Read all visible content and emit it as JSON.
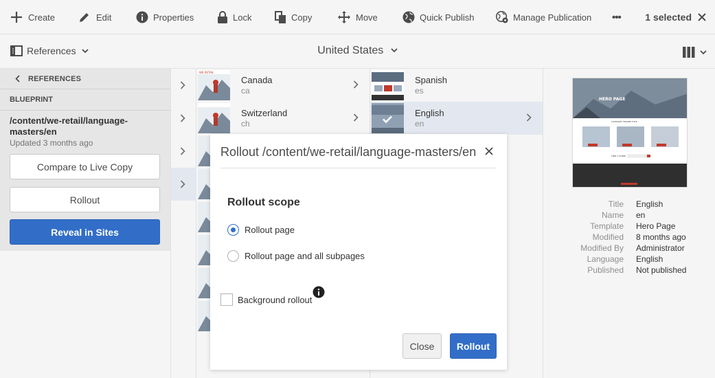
{
  "toolbar": {
    "create": "Create",
    "edit": "Edit",
    "properties": "Properties",
    "lock": "Lock",
    "copy": "Copy",
    "move": "Move",
    "quick_publish": "Quick Publish",
    "manage_publication": "Manage Publication",
    "more": "•••",
    "selected": "1 selected"
  },
  "navbar": {
    "rail_toggle": "References",
    "title": "United States"
  },
  "rail": {
    "back_label": "REFERENCES",
    "section": "BLUEPRINT",
    "path": "/content/we-retail/language-masters/en",
    "updated": "Updated 3 months ago",
    "compare_btn": "Compare to Live Copy",
    "rollout_btn": "Rollout",
    "reveal_btn": "Reveal in Sites"
  },
  "columns": {
    "col2": [
      {
        "title": "Canada",
        "sub": "ca"
      },
      {
        "title": "Switzerland",
        "sub": "ch"
      }
    ],
    "col3": [
      {
        "title": "Spanish",
        "sub": "es"
      },
      {
        "title": "English",
        "sub": "en"
      }
    ],
    "thumb_label": "WE.RETAIL"
  },
  "info": {
    "labels": [
      "Title",
      "Name",
      "Template",
      "Modified",
      "Modified By",
      "Language",
      "Published"
    ],
    "values": [
      "English",
      "en",
      "Hero Page",
      "8 months ago",
      "Administrator",
      "English",
      "Not published"
    ],
    "preview_hero": "HERO PAGE",
    "preview_tagline": "CATEGORY TEASER TITLE",
    "preview_find": "FIND A STORE"
  },
  "dialog": {
    "title": "Rollout /content/we-retail/language-masters/en",
    "scope_heading": "Rollout scope",
    "option_page": "Rollout page",
    "option_all": "Rollout page and all subpages",
    "selected_option": "Rollout page",
    "background": "Background rollout",
    "close_btn": "Close",
    "rollout_btn": "Rollout"
  },
  "colors": {
    "accent": "#326ec8",
    "selection": "#e3e8f0",
    "rail_bg": "#e6e6e6"
  }
}
